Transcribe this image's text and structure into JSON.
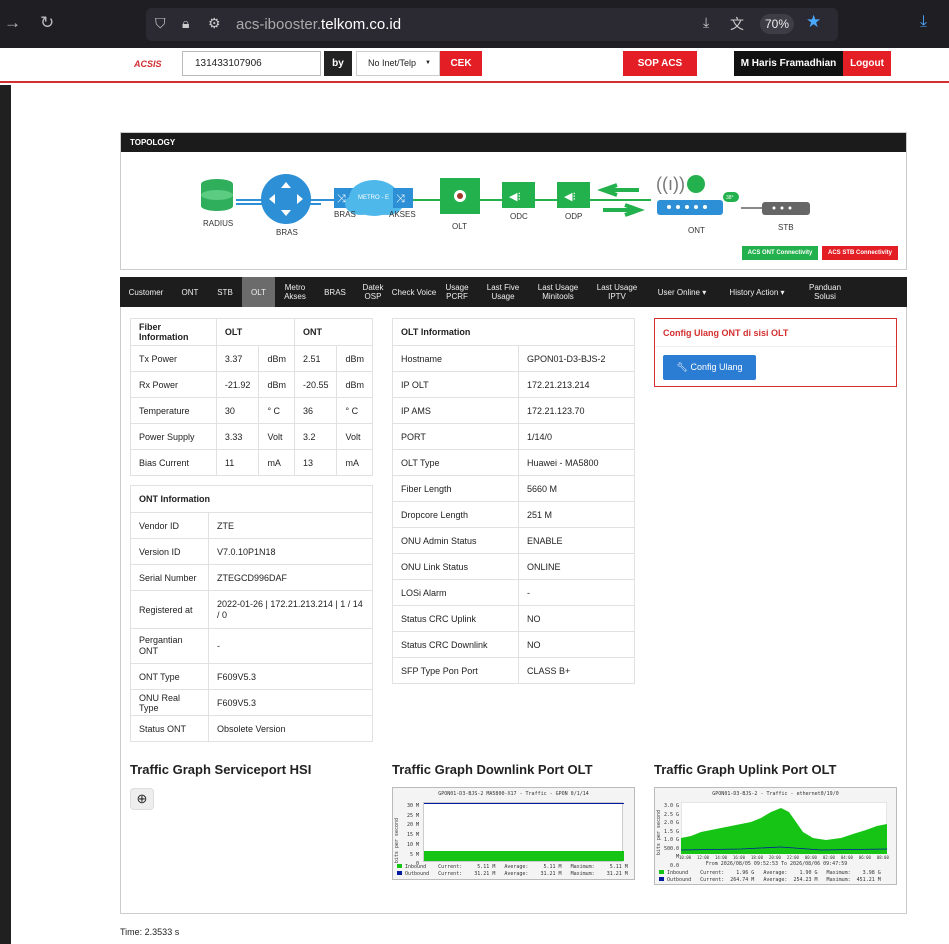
{
  "browser": {
    "url_prefix": "acs-ibooster.",
    "url_domain": "telkom.co.id",
    "zoom": "70%"
  },
  "topbar": {
    "logo": "ACSIS",
    "search_value": "131433107906",
    "by_label": "by",
    "select_value": "No Inet/Telp",
    "cek_label": "CEK",
    "sop_label": "SOP ACS",
    "user_label": "M Haris Framadhian",
    "logout_label": "Logout"
  },
  "topology": {
    "title": "TOPOLOGY",
    "nodes": {
      "radius": "RADIUS",
      "bras": "BRAS",
      "bras2": "BRAS",
      "metro": "METRO - E",
      "akses": "AKSES",
      "olt": "OLT",
      "odc": "ODC",
      "odp": "ODP",
      "ont": "ONT",
      "stb": "STB",
      "ont_badge": "38°"
    },
    "ont_conn": "ACS ONT Connectivity",
    "stb_conn": "ACS STB Connectivity"
  },
  "tabs": [
    {
      "label": "Customer"
    },
    {
      "label": "ONT"
    },
    {
      "label": "STB"
    },
    {
      "label": "OLT"
    },
    {
      "label": "Metro Akses"
    },
    {
      "label": "BRAS"
    },
    {
      "label": "Datek OSP"
    },
    {
      "label": "Check Voice"
    },
    {
      "label": "Usage PCRF"
    },
    {
      "label": "Last Five Usage"
    },
    {
      "label": "Last Usage Minitools"
    },
    {
      "label": "Last Usage IPTV"
    },
    {
      "label": "User Online ▾"
    },
    {
      "label": "History Action ▾"
    },
    {
      "label": "Panduan Solusi"
    }
  ],
  "fiber": {
    "headers": [
      "Fiber Information",
      "OLT",
      "ONT"
    ],
    "rows": [
      [
        "Tx Power",
        "3.37",
        "dBm",
        "2.51",
        "dBm"
      ],
      [
        "Rx Power",
        "-21.92",
        "dBm",
        "-20.55",
        "dBm"
      ],
      [
        "Temperature",
        "30",
        "° C",
        "36",
        "° C"
      ],
      [
        "Power Supply",
        "3.33",
        "Volt",
        "3.2",
        "Volt"
      ],
      [
        "Bias Current",
        "11",
        "mA",
        "13",
        "mA"
      ]
    ]
  },
  "ont_info": {
    "title": "ONT Information",
    "rows": [
      [
        "Vendor ID",
        "ZTE"
      ],
      [
        "Version ID",
        "V7.0.10P1N18"
      ],
      [
        "Serial Number",
        "ZTEGCD996DAF"
      ],
      [
        "Registered at",
        "2022-01-26 | 172.21.213.214 | 1 / 14 / 0"
      ],
      [
        "Pergantian ONT",
        "-"
      ],
      [
        "ONT Type",
        "F609V5.3"
      ],
      [
        "ONU Real Type",
        "F609V5.3"
      ],
      [
        "Status ONT",
        "Obsolete Version"
      ]
    ]
  },
  "olt_info": {
    "title": "OLT Information",
    "rows": [
      [
        "Hostname",
        "GPON01-D3-BJS-2"
      ],
      [
        "IP OLT",
        "172.21.213.214"
      ],
      [
        "IP AMS",
        "172.21.123.70"
      ],
      [
        "PORT",
        "1/14/0"
      ],
      [
        "OLT Type",
        "Huawei - MA5800"
      ],
      [
        "Fiber Length",
        "5660 M"
      ],
      [
        "Dropcore Length",
        "251 M"
      ],
      [
        "ONU Admin Status",
        "ENABLE"
      ],
      [
        "ONU Link Status",
        "ONLINE"
      ],
      [
        "LOSi Alarm",
        "-"
      ],
      [
        "Status CRC Uplink",
        "NO"
      ],
      [
        "Status CRC Downlink",
        "NO"
      ],
      [
        "SFP Type Pon Port",
        "CLASS B+"
      ]
    ]
  },
  "config": {
    "title": "Config Ulang ONT di sisi OLT",
    "button": "Config Ulang"
  },
  "graphs": {
    "hsi_title": "Traffic Graph Serviceport HSI",
    "down_title": "Traffic Graph Downlink Port OLT",
    "up_title": "Traffic Graph Uplink Port OLT",
    "down": {
      "header": "GPON01-D3-BJS-2 MA5800-X17 - Traffic - GPON 0/1/14",
      "yaxis": "bits per second",
      "in_line": "Inbound    Current:     5.11 M   Average:     5.11 M   Maximum:     5.11 M",
      "out_line": "Outbound   Current:    31.21 M   Average:    31.21 M   Maximum:    31.21 M",
      "ticks": [
        "30 M",
        "25 M",
        "20 M",
        "15 M",
        "10 M",
        "5 M",
        "0"
      ]
    },
    "up": {
      "header": "GPON01-D3-BJS-2 - Traffic - ethernet0/19/0",
      "yaxis": "bits per second",
      "in_line": "Inbound    Current:    1.96 G   Average:    1.90 G   Maximum:    3.98 G",
      "out_line": "Outbound   Current:  264.74 M   Average:  254.23 M   Maximum:  451.21 M",
      "from_line": "From 2026/08/05 09:52:53 To 2026/08/06 09:47:59",
      "ticks": [
        "3.0 G",
        "2.5 G",
        "2.0 G",
        "1.5 G",
        "1.0 G",
        "500.0 M",
        "0.0"
      ],
      "xticks": [
        "10:00",
        "12:00",
        "14:00",
        "16:00",
        "18:00",
        "20:00",
        "22:00",
        "00:00",
        "02:00",
        "04:00",
        "06:00",
        "08:00"
      ]
    }
  },
  "footer": {
    "time": "Time: 2.3533 s"
  }
}
